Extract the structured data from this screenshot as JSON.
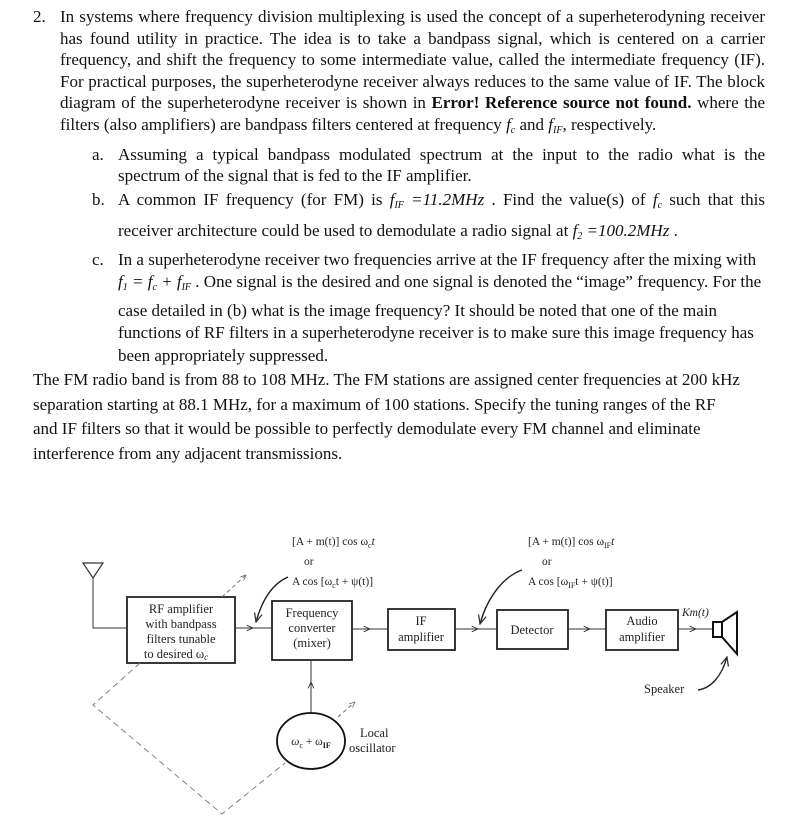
{
  "problem": {
    "number": "2.",
    "intro_1": "In systems where frequency division multiplexing is used the concept of a superheterodyning receiver has found utility in practice. The idea is to take a bandpass signal, which is centered on a carrier frequency, and shift the frequency to some intermediate value, called the intermediate frequency (IF). For practical purposes, the superheterodyne receiver always reduces to the same value of IF. The block diagram of the superheterodyne receiver is shown in ",
    "intro_error": "Error! Reference source not found.",
    "intro_2": " where the filters (also amplifiers) are bandpass filters centered at frequency ",
    "intro_fc": "f",
    "intro_fc_sub": "c",
    "intro_and": " and ",
    "intro_fif": "f",
    "intro_fif_sub": "IF",
    "intro_end": ", respectively.",
    "parts": [
      {
        "label": "a.",
        "text": "Assuming a typical bandpass modulated spectrum at the input to the radio what is the spectrum of the signal that is fed to the IF amplifier."
      },
      {
        "label": "b.",
        "text_1": "A common IF frequency (for FM) is ",
        "eq_1": "f",
        "eq_1_sub": "IF",
        "eq_1_rhs": " =11.2MHz",
        "text_2": " . Find the value(s) of ",
        "eq_2": "f",
        "eq_2_sub": "c",
        "text_3": " such that this receiver architecture could be used to demodulate a radio signal at ",
        "eq_3": "f",
        "eq_3_sub": "2",
        "eq_3_rhs": " =100.2MHz",
        "text_4": " ."
      },
      {
        "label": "c.",
        "text_1": "In a superheterodyne receiver two frequencies arrive at the IF frequency after the mixing with ",
        "eq": "f",
        "eq_sub": "1",
        "eq_mid": " = f",
        "eq_mid_sub": "c",
        "eq_plus": " + f",
        "eq_plus_sub": "IF",
        "text_2": " . One signal is the desired and one signal is denoted the “image” frequency. For the case detailed in (b) what is the image frequency? It should be noted that one of the main functions of RF filters in a superheterodyne receiver is to make sure this image frequency has been appropriately suppressed."
      }
    ],
    "closing": "The FM radio band is from 88 to 108 MHz. The FM stations are assigned center frequencies at 200 kHz separation starting at 88.1 MHz, for a maximum of 100 stations. Specify the tuning ranges of the RF and IF filters so that it would be possible to perfectly demodulate every FM channel and eliminate interference from any adjacent transmissions."
  },
  "diagram": {
    "rf_block": [
      "RF amplifier",
      "with bandpass",
      "filters tunable",
      "to desired ω"
    ],
    "rf_block_sub": "c",
    "mixer_block": [
      "Frequency",
      "converter",
      "(mixer)"
    ],
    "if_block": [
      "IF",
      "amplifier"
    ],
    "detector_block": "Detector",
    "audio_block": [
      "Audio",
      "amplifier"
    ],
    "oscillator_label": "ω",
    "oscillator_sub": "c",
    "oscillator_plus": " + ω",
    "oscillator_plus_sub": "IF",
    "oscillator_caption": [
      "Local",
      "oscillator"
    ],
    "speaker_label": "Speaker",
    "output_label": "Km(t)",
    "rf_signal": {
      "line1": "[A + m(t)] cos ω",
      "line1_sub": "c",
      "line1_end": "t",
      "or": "or",
      "line3": "A cos [ω",
      "line3_sub": "c",
      "line3_end": "t + ψ(t)]"
    },
    "if_signal": {
      "line1": "[A + m(t)] cos ω",
      "line1_sub": "IF",
      "line1_end": "t",
      "or": "or",
      "line3": "A cos [ω",
      "line3_sub": "IF",
      "line3_end": "t + ψ(t)]"
    }
  }
}
